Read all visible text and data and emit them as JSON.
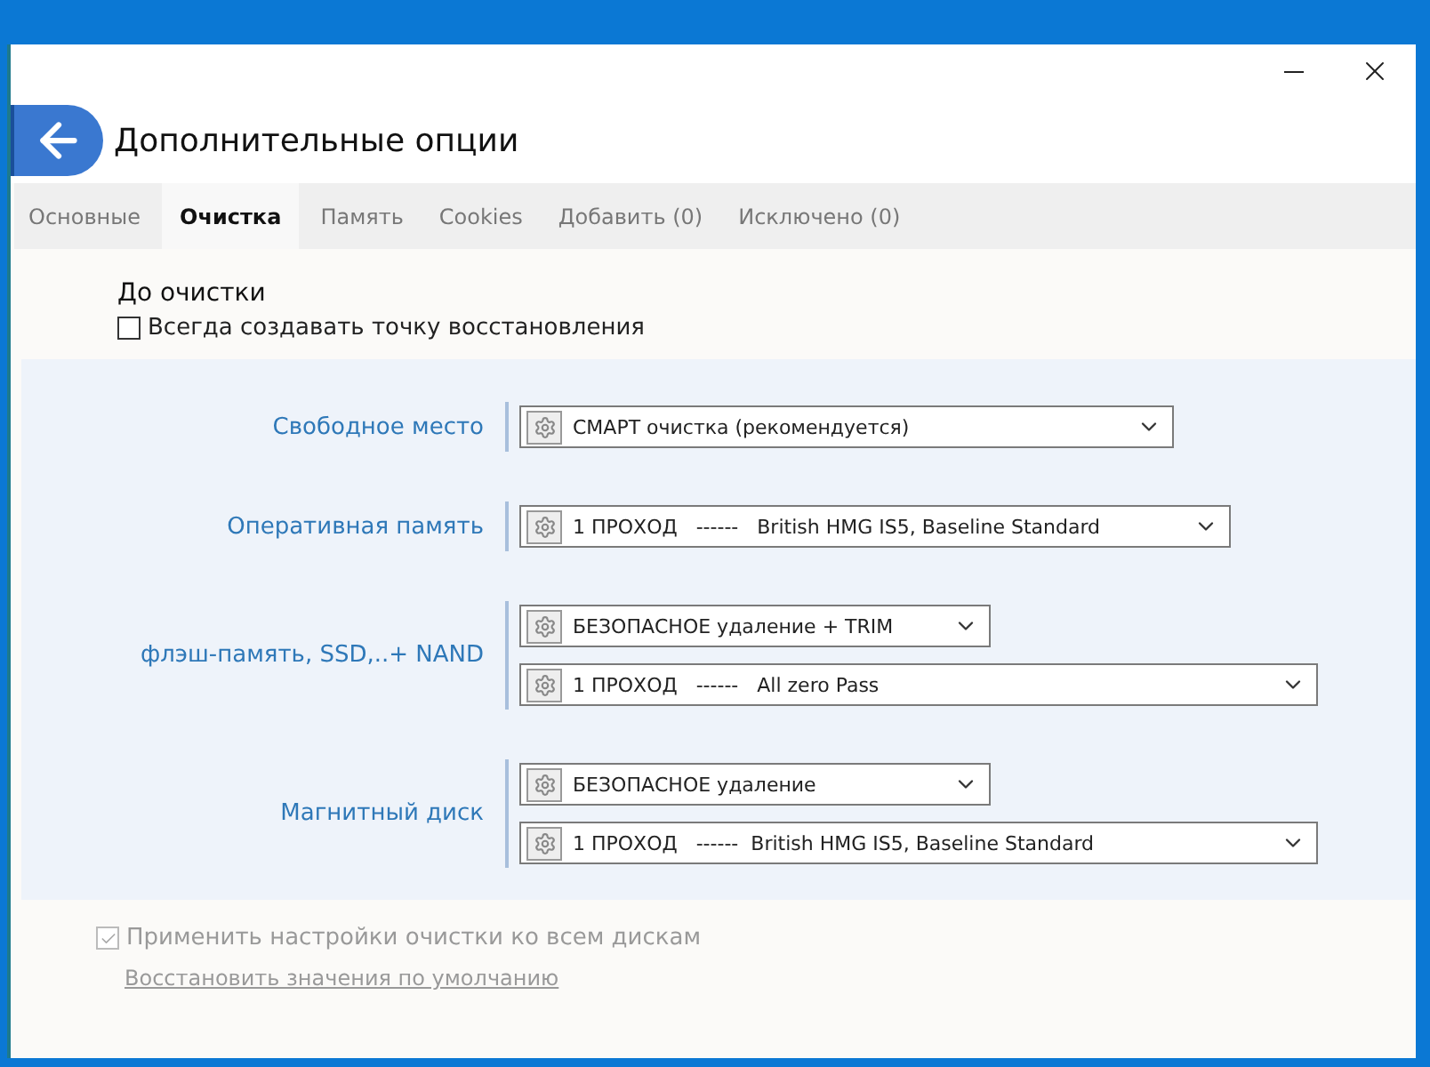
{
  "window": {
    "title": "Дополнительные опции"
  },
  "tabs": [
    {
      "label": "Основные",
      "selected": false
    },
    {
      "label": "Очистка",
      "selected": true
    },
    {
      "label": "Память",
      "selected": false
    },
    {
      "label": "Cookies",
      "selected": false
    },
    {
      "label": "Добавить (0)",
      "selected": false
    },
    {
      "label": "Исключено (0)",
      "selected": false
    }
  ],
  "before_cleanup": {
    "heading": "До очистки",
    "checkbox": {
      "label": "Всегда создавать точку восстановления",
      "checked": false
    }
  },
  "groups": [
    {
      "label": "Свободное место",
      "dropdowns": [
        {
          "value": "СМАРТ очистка (рекомендуется)"
        }
      ]
    },
    {
      "label": "Оперативная память",
      "dropdowns": [
        {
          "value": "1 ПРОХОД   ------   British HMG IS5, Baseline Standard"
        }
      ]
    },
    {
      "label": "флэш-память, SSD,..+ NAND",
      "dropdowns": [
        {
          "value": "БЕЗОПАСНОЕ удаление + TRIM"
        },
        {
          "value": "1 ПРОХОД   ------   All zero Pass"
        }
      ]
    },
    {
      "label": "Магнитный диск",
      "dropdowns": [
        {
          "value": "БЕЗОПАСНОЕ удаление"
        },
        {
          "value": "1 ПРОХОД   ------  British HMG IS5, Baseline Standard"
        }
      ]
    }
  ],
  "footer": {
    "apply_all": {
      "label": "Применить настройки очистки ко всем дискам",
      "checked": true,
      "disabled": true
    },
    "restore_link": {
      "text": "Восстановить значения по умолчанию",
      "disabled": true
    }
  }
}
